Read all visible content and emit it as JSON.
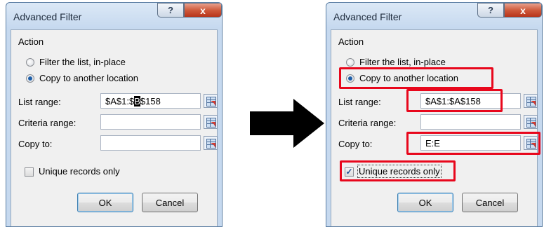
{
  "dialogs": {
    "before": {
      "title": "Advanced Filter",
      "action_label": "Action",
      "radio_filter_in_place": "Filter the list, in-place",
      "radio_copy_to_location": "Copy to another location",
      "list_range_label": "List range:",
      "list_range_pre": "$A$1:$",
      "list_range_sel": "B",
      "list_range_post": "$158",
      "criteria_range_label": "Criteria range:",
      "criteria_range_value": "",
      "copy_to_label": "Copy to:",
      "copy_to_value": "",
      "unique_records_label": "Unique records only",
      "unique_records_checked": false,
      "ok_label": "OK",
      "cancel_label": "Cancel",
      "help_glyph": "?",
      "close_glyph": "x"
    },
    "after": {
      "title": "Advanced Filter",
      "action_label": "Action",
      "radio_filter_in_place": "Filter the list, in-place",
      "radio_copy_to_location": "Copy to another location",
      "list_range_label": "List range:",
      "list_range_value": "$A$1:$A$158",
      "criteria_range_label": "Criteria range:",
      "criteria_range_value": "",
      "copy_to_label": "Copy to:",
      "copy_to_value": "E:E",
      "unique_records_label": "Unique records only",
      "unique_records_checked": true,
      "check_glyph": "✓",
      "ok_label": "OK",
      "cancel_label": "Cancel",
      "help_glyph": "?",
      "close_glyph": "x"
    }
  },
  "selected_radio": "copy_to_location",
  "icons": {
    "ref": "collapse-dialog-icon",
    "arrow": "right-arrow-icon"
  },
  "colors": {
    "highlight": "#e8071c",
    "title_bar": "#c6d9ef",
    "close_button": "#cf5a3c"
  }
}
